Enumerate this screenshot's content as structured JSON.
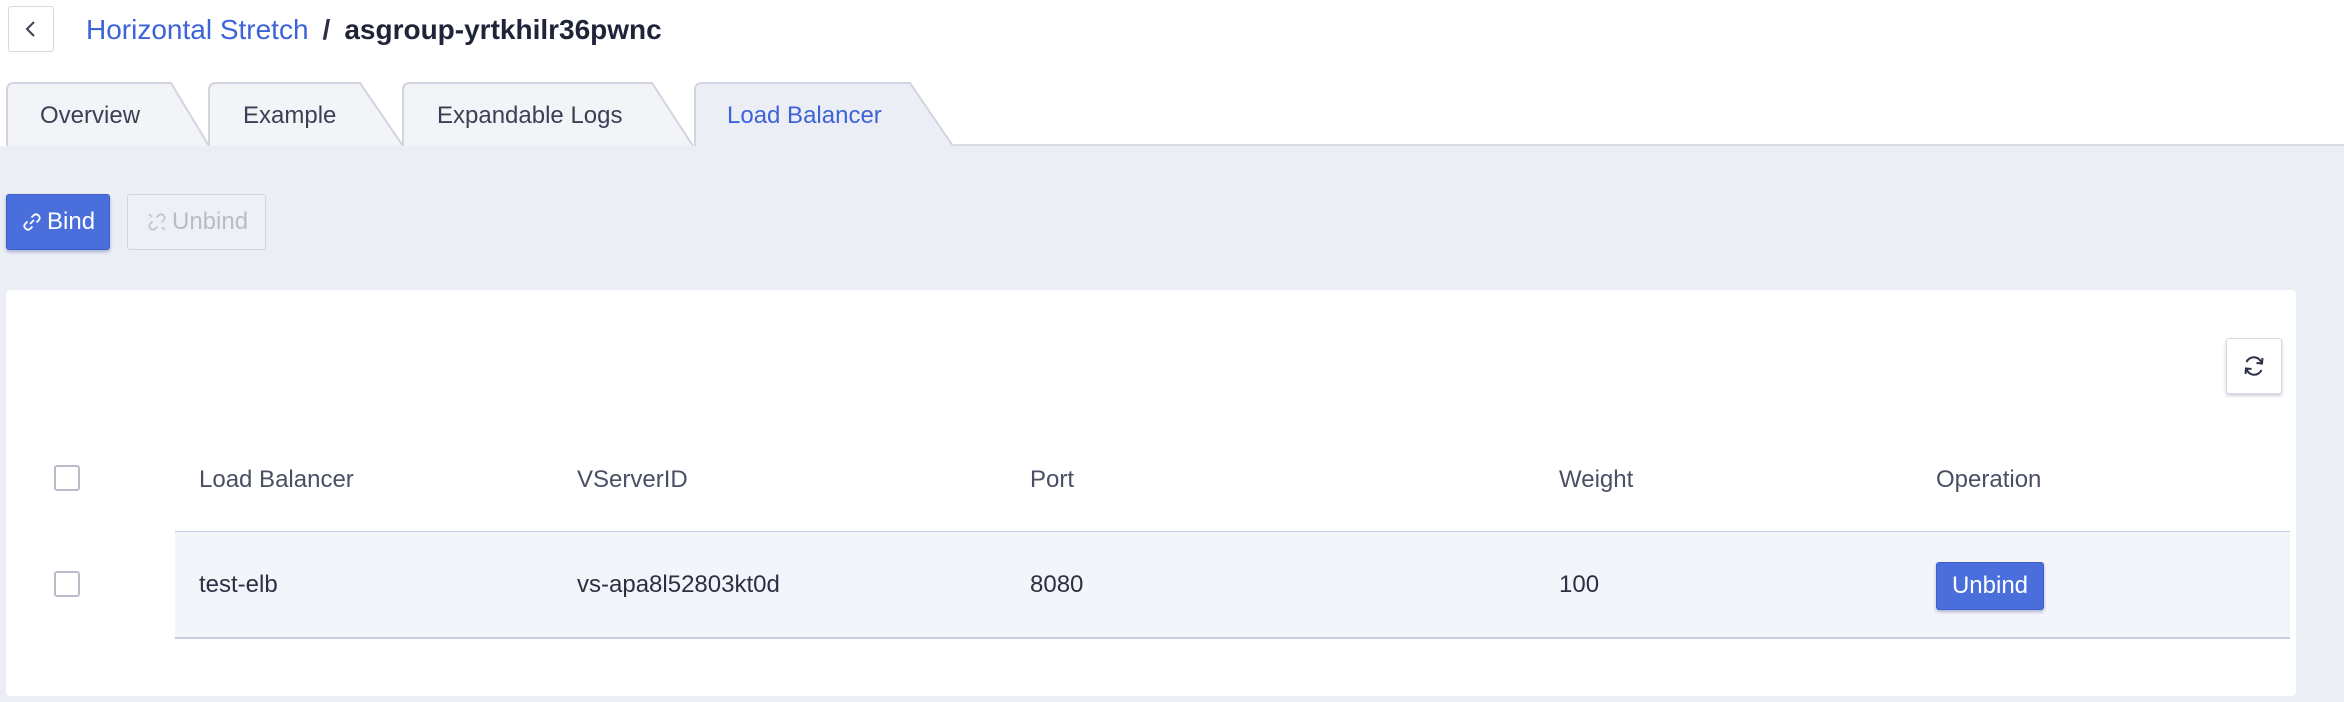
{
  "breadcrumb": {
    "parent": "Horizontal Stretch",
    "separator": "/",
    "current": "asgroup-yrtkhilr36pwnc"
  },
  "tabs": [
    {
      "label": "Overview",
      "active": false
    },
    {
      "label": "Example",
      "active": false
    },
    {
      "label": "Expandable Logs",
      "active": false
    },
    {
      "label": "Load Balancer",
      "active": true
    }
  ],
  "toolbar": {
    "bind_label": "Bind",
    "unbind_label": "Unbind",
    "unbind_disabled": true
  },
  "table": {
    "columns": [
      "Load Balancer",
      "VServerID",
      "Port",
      "Weight",
      "Operation"
    ],
    "rows": [
      {
        "load_balancer": "test-elb",
        "vserver_id": "vs-apa8l52803kt0d",
        "port": "8080",
        "weight": "100",
        "operation_label": "Unbind"
      }
    ]
  },
  "colors": {
    "accent": "#4a6fdc",
    "link": "#3d63d9",
    "content_bg": "#eceef5"
  }
}
